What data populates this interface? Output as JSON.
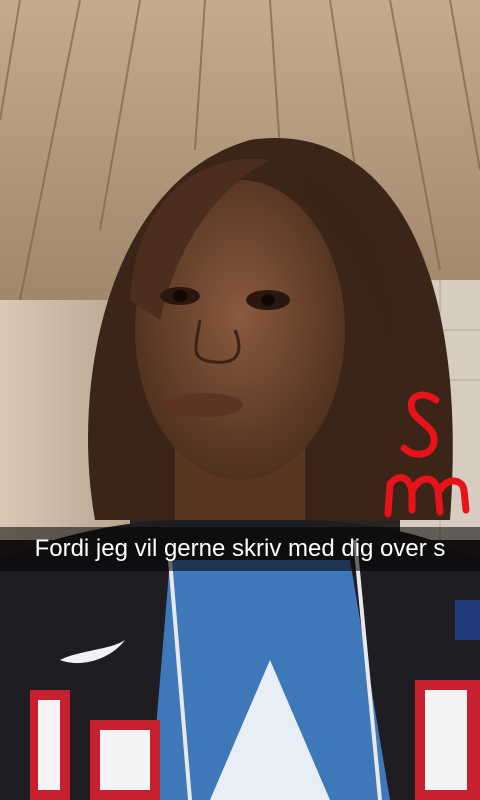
{
  "snap": {
    "caption": "Fordi jeg vil gerne skriv med dig over s",
    "doodle_letters": "sm",
    "doodle_color": "#e8121b",
    "caption_bar_color": "rgba(0,0,0,0.55)"
  }
}
